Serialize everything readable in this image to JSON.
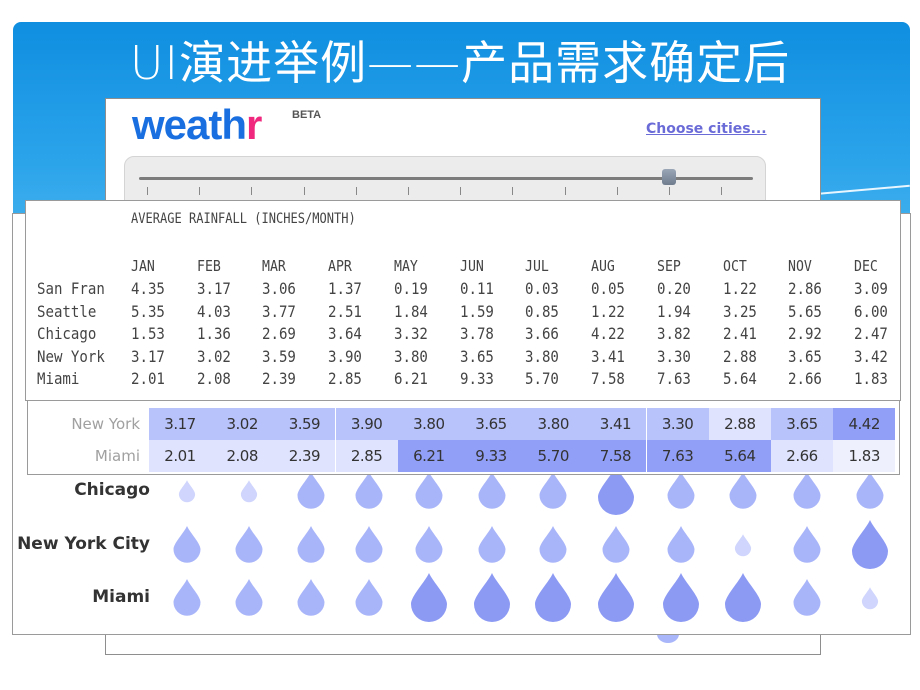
{
  "slide": {
    "title": "UI演进举例——产品需求确定后"
  },
  "app": {
    "logo_main": "weath",
    "logo_accent": "r",
    "beta_label": "BETA",
    "choose_cities_link": "Choose cities...",
    "slider": {
      "selected_index": 10,
      "tick_count": 12
    }
  },
  "colors": {
    "slide_blue": "#0f8ee0",
    "logo_blue": "#1a6fe0",
    "logo_pink": "#f0287e",
    "link_purple": "#6b6bd8",
    "heat_light": "#e4e8fd",
    "heat_mid": "#b8c2fb",
    "heat_dark": "#8e9cf5"
  },
  "raw_table": {
    "title": "AVERAGE RAINFALL (INCHES/MONTH)",
    "months": [
      "JAN",
      "FEB",
      "MAR",
      "APR",
      "MAY",
      "JUN",
      "JUL",
      "AUG",
      "SEP",
      "OCT",
      "NOV",
      "DEC"
    ],
    "rows": [
      {
        "city": "San Fran",
        "values": [
          "4.35",
          "3.17",
          "3.06",
          "1.37",
          "0.19",
          "0.11",
          "0.03",
          "0.05",
          "0.20",
          "1.22",
          "2.86",
          "3.09"
        ]
      },
      {
        "city": "Seattle",
        "values": [
          "5.35",
          "4.03",
          "3.77",
          "2.51",
          "1.84",
          "1.59",
          "0.85",
          "1.22",
          "1.94",
          "3.25",
          "5.65",
          "6.00"
        ]
      },
      {
        "city": "Chicago",
        "values": [
          "1.53",
          "1.36",
          "2.69",
          "3.64",
          "3.32",
          "3.78",
          "3.66",
          "4.22",
          "3.82",
          "2.41",
          "2.92",
          "2.47"
        ]
      },
      {
        "city": "New York",
        "values": [
          "3.17",
          "3.02",
          "3.59",
          "3.90",
          "3.80",
          "3.65",
          "3.80",
          "3.41",
          "3.30",
          "2.88",
          "3.65",
          "3.42"
        ]
      },
      {
        "city": "Miami",
        "values": [
          "2.01",
          "2.08",
          "2.39",
          "2.85",
          "6.21",
          "9.33",
          "5.70",
          "7.58",
          "7.63",
          "5.64",
          "2.66",
          "1.83"
        ]
      }
    ]
  },
  "heat_table": {
    "rows": [
      {
        "city": "New York",
        "values": [
          "3.17",
          "3.02",
          "3.59",
          "3.90",
          "3.80",
          "3.65",
          "3.80",
          "3.41",
          "3.30",
          "2.88",
          "3.65",
          "4.42"
        ],
        "levels": [
          2,
          2,
          2,
          2,
          2,
          2,
          2,
          2,
          2,
          1,
          2,
          3
        ]
      },
      {
        "city": "Miami",
        "values": [
          "2.01",
          "2.08",
          "2.39",
          "2.85",
          "6.21",
          "9.33",
          "5.70",
          "7.58",
          "7.63",
          "5.64",
          "2.66",
          "1.83"
        ],
        "levels": [
          1,
          1,
          1,
          1,
          3,
          3,
          3,
          3,
          3,
          3,
          1,
          0
        ]
      }
    ]
  },
  "drops": {
    "rows": [
      {
        "city": "Chicago",
        "levels": [
          0,
          0,
          2,
          2,
          2,
          2,
          2,
          3,
          2,
          2,
          2,
          2
        ]
      },
      {
        "city": "New York City",
        "levels": [
          2,
          2,
          2,
          2,
          2,
          2,
          2,
          2,
          2,
          0,
          2,
          3
        ]
      },
      {
        "city": "Miami",
        "levels": [
          2,
          2,
          2,
          2,
          3,
          3,
          3,
          3,
          3,
          3,
          2,
          0
        ]
      }
    ]
  },
  "legend": {
    "label": "Miami"
  }
}
